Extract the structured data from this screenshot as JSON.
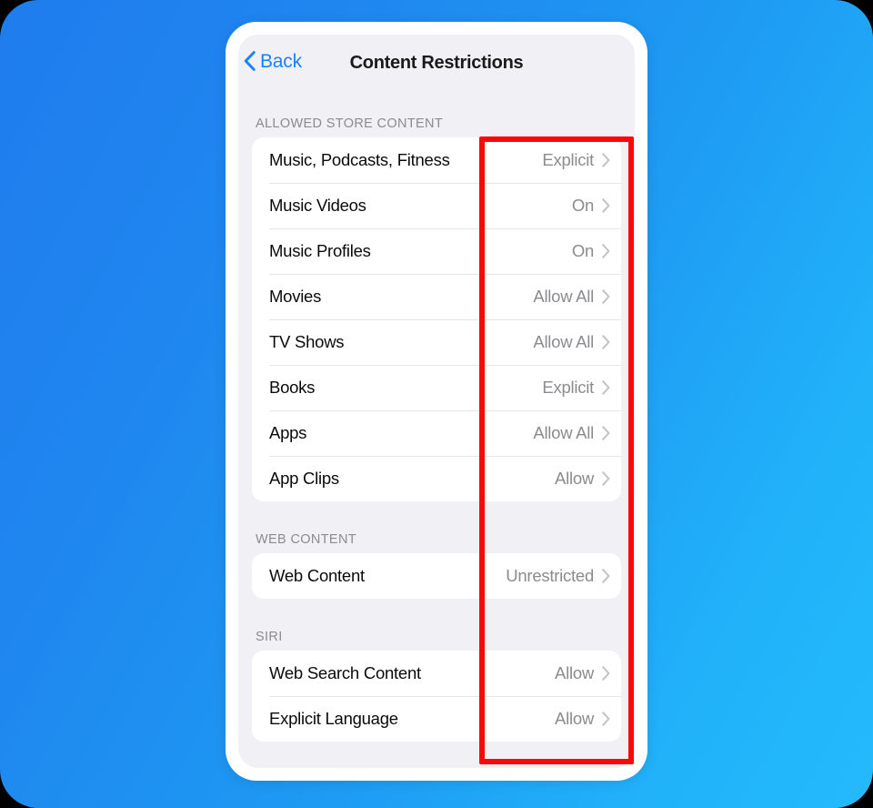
{
  "window": {
    "background_gradient_from": "#1f7ced",
    "background_gradient_to": "#23bafb"
  },
  "nav": {
    "back_label": "Back",
    "title": "Content Restrictions",
    "back_icon": "chevron-left-icon",
    "accent_color": "#1782ff"
  },
  "annotation": {
    "shape": "rectangle",
    "color": "#fb0808",
    "target": "settings-value-column"
  },
  "sections": [
    {
      "header": "ALLOWED STORE CONTENT",
      "rows": [
        {
          "label": "Music, Podcasts, Fitness",
          "value": "Explicit"
        },
        {
          "label": "Music Videos",
          "value": "On"
        },
        {
          "label": "Music Profiles",
          "value": "On"
        },
        {
          "label": "Movies",
          "value": "Allow All"
        },
        {
          "label": "TV Shows",
          "value": "Allow All"
        },
        {
          "label": "Books",
          "value": "Explicit"
        },
        {
          "label": "Apps",
          "value": "Allow All"
        },
        {
          "label": "App Clips",
          "value": "Allow"
        }
      ]
    },
    {
      "header": "WEB CONTENT",
      "rows": [
        {
          "label": "Web Content",
          "value": "Unrestricted"
        }
      ]
    },
    {
      "header": "SIRI",
      "rows": [
        {
          "label": "Web Search Content",
          "value": "Allow"
        },
        {
          "label": "Explicit Language",
          "value": "Allow"
        }
      ]
    }
  ]
}
